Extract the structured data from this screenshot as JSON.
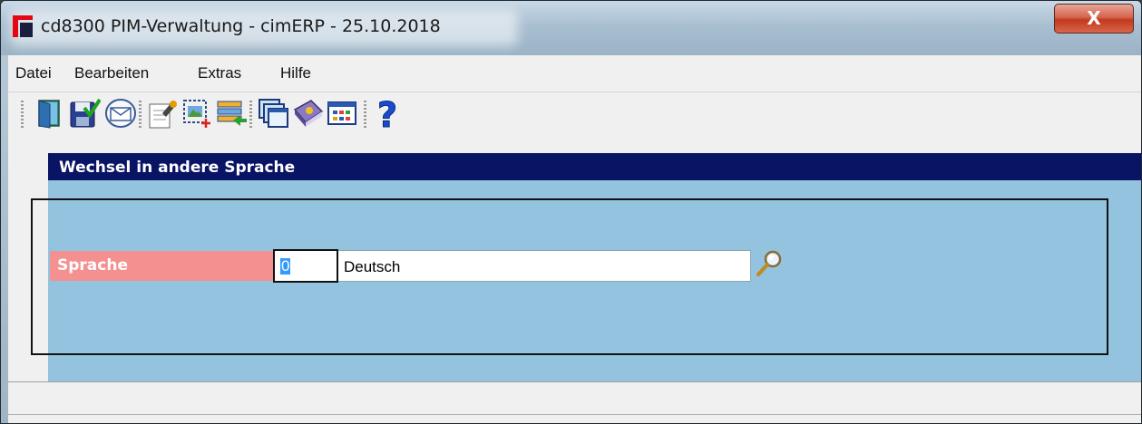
{
  "window": {
    "title": "cd8300 PIM-Verwaltung - cimERP - 25.10.2018",
    "close_label": "X"
  },
  "menu": {
    "items": [
      "Datei",
      "Bearbeiten",
      "Extras",
      "Hilfe"
    ]
  },
  "toolbar": {
    "buttons": [
      "exit-door-icon",
      "save-check-icon",
      "envelope-icon",
      "edit-document-icon",
      "new-record-icon",
      "list-transfer-icon",
      "windows-icon",
      "book-icon",
      "grid-table-icon",
      "help-question-icon"
    ]
  },
  "panel": {
    "header": "Wechsel in andere Sprache"
  },
  "form": {
    "label": "Sprache",
    "code_value": "0",
    "name_value": "Deutsch"
  },
  "colors": {
    "header_bg": "#0a1464",
    "panel_bg": "#93c3de",
    "label_bg": "#f59090"
  }
}
